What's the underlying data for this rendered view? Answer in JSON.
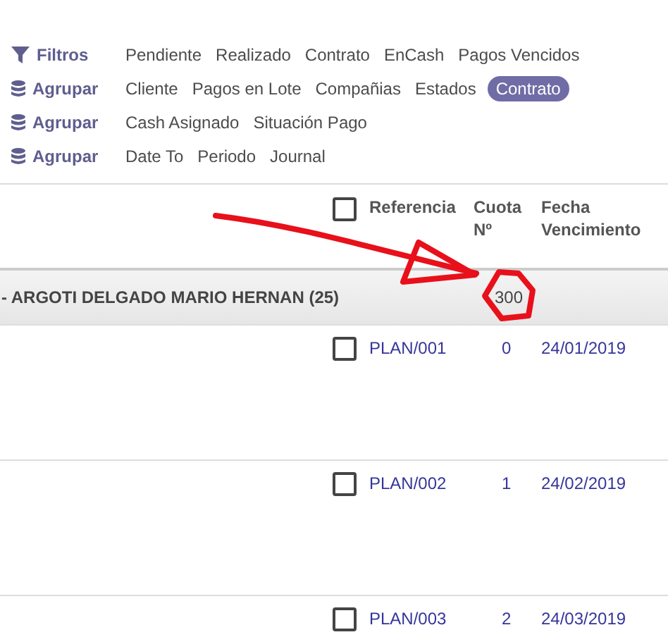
{
  "filters": [
    {
      "kind": "filter",
      "label": "Filtros",
      "items": [
        {
          "label": "Pendiente",
          "selected": false
        },
        {
          "label": "Realizado",
          "selected": false
        },
        {
          "label": "Contrato",
          "selected": false
        },
        {
          "label": "EnCash",
          "selected": false
        },
        {
          "label": "Pagos Vencidos",
          "selected": false
        }
      ]
    },
    {
      "kind": "group",
      "label": "Agrupar",
      "items": [
        {
          "label": "Cliente",
          "selected": false
        },
        {
          "label": "Pagos en Lote",
          "selected": false
        },
        {
          "label": "Compañias",
          "selected": false
        },
        {
          "label": "Estados",
          "selected": false
        },
        {
          "label": "Contrato",
          "selected": true
        }
      ]
    },
    {
      "kind": "group",
      "label": "Agrupar",
      "items": [
        {
          "label": "Cash Asignado",
          "selected": false
        },
        {
          "label": "Situación Pago",
          "selected": false
        }
      ]
    },
    {
      "kind": "group",
      "label": "Agrupar",
      "items": [
        {
          "label": "Date To",
          "selected": false
        },
        {
          "label": "Periodo",
          "selected": false
        },
        {
          "label": "Journal",
          "selected": false
        }
      ]
    }
  ],
  "table": {
    "all_checked": false,
    "columns": [
      "Referencia",
      "Cuota Nº",
      "Fecha Vencimiento"
    ],
    "group": {
      "label": "- ARGOTI DELGADO MARIO HERNAN (25)",
      "total": "300"
    },
    "rows": [
      {
        "checked": false,
        "cells": [
          "PLAN/001",
          "0",
          "24/01/2019"
        ]
      },
      {
        "checked": false,
        "cells": [
          "PLAN/002",
          "1",
          "24/02/2019"
        ]
      },
      {
        "checked": false,
        "cells": [
          "PLAN/003",
          "2",
          "24/03/2019"
        ]
      }
    ]
  }
}
